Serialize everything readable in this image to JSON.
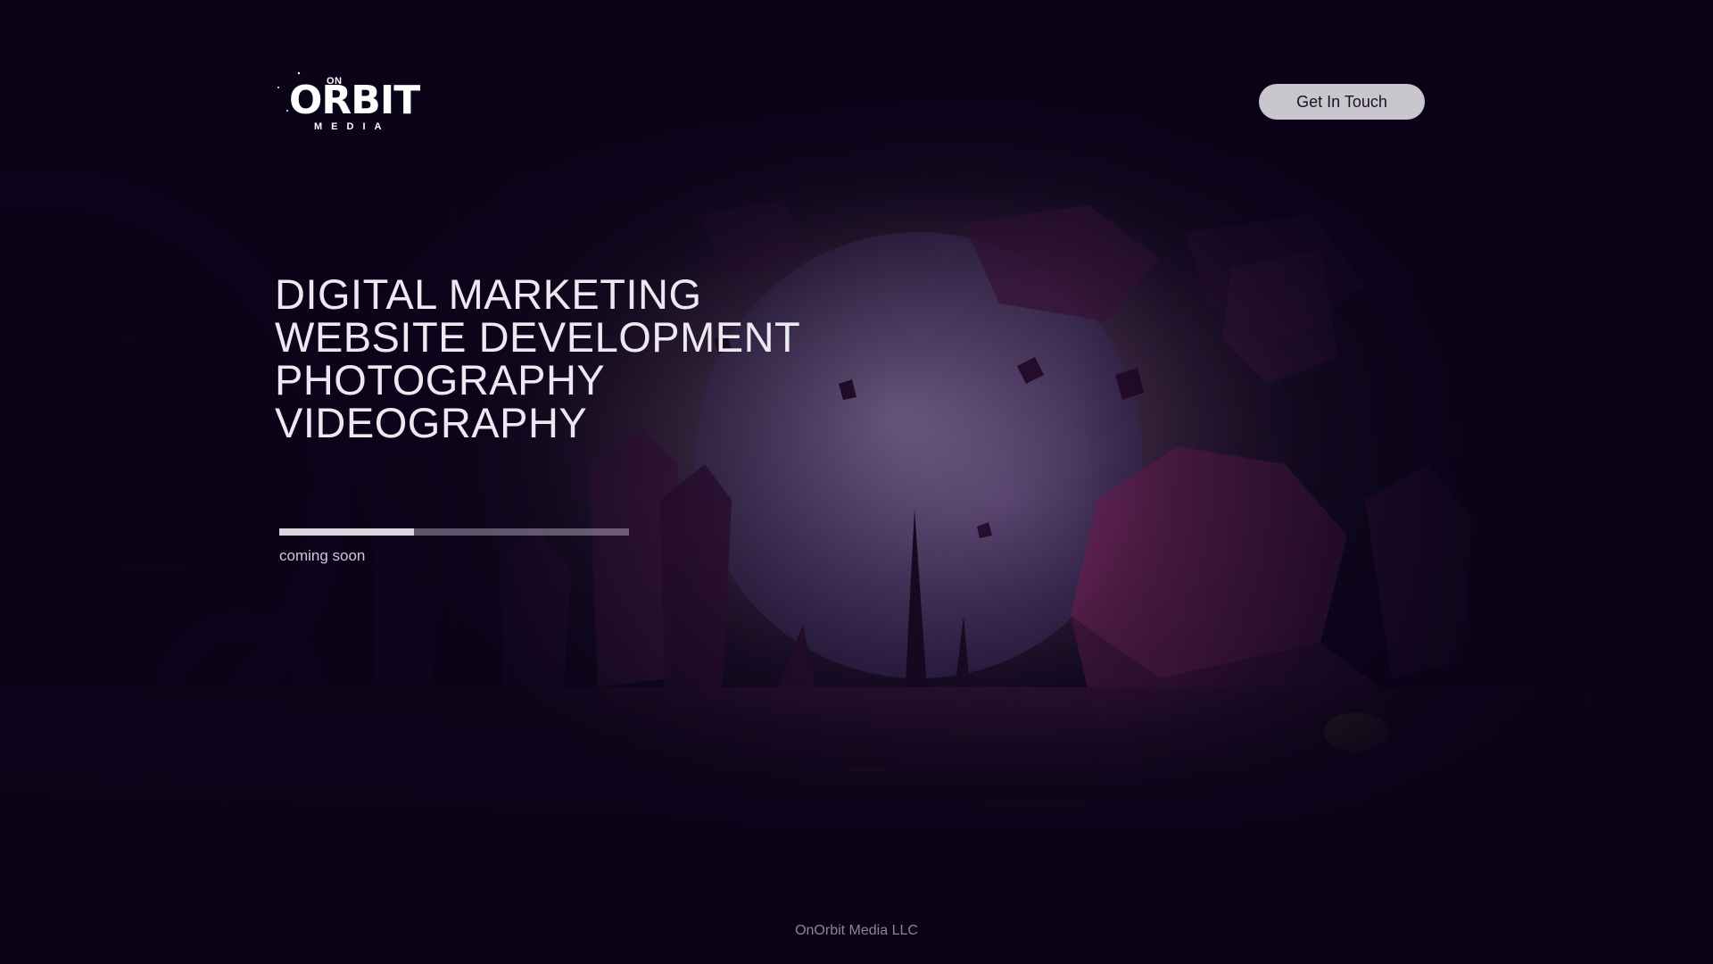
{
  "header": {
    "logo": {
      "top_text": "ON",
      "main_text": "ORBIT",
      "sub_text": "MEDIA"
    },
    "cta_label": "Get In Touch"
  },
  "hero": {
    "services": [
      "DIGITAL MARKETING",
      "WEBSITE DEVELOPMENT",
      "PHOTOGRAPHY",
      "VIDEOGRAPHY"
    ],
    "progress_fraction": 0.385,
    "status_text": "coming soon"
  },
  "footer": {
    "text": "OnOrbit Media LLC"
  },
  "colors": {
    "background": "#0b0419",
    "accent_button": "#c9c6ce",
    "text_primary": "#ece9f1",
    "scene_rock": "#5a1f4e",
    "scene_glow": "#d8b6c8"
  }
}
